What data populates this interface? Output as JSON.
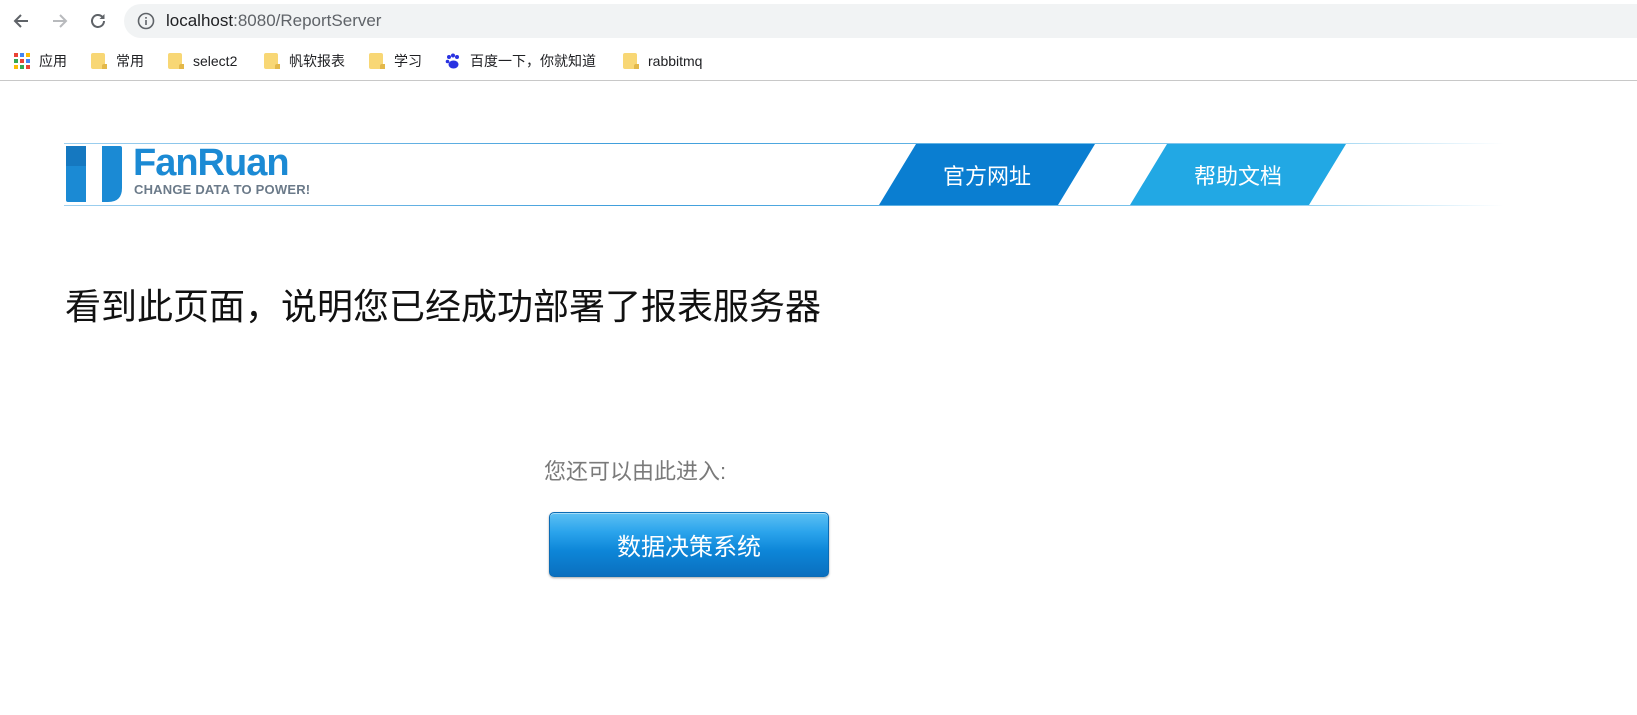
{
  "browser": {
    "url_host": "localhost",
    "url_rest": ":8080/ReportServer",
    "bookmarks": [
      {
        "label": "应用",
        "icon": "apps-grid-icon"
      },
      {
        "label": "常用",
        "icon": "folder-icon"
      },
      {
        "label": "select2",
        "icon": "folder-icon"
      },
      {
        "label": "帆软报表",
        "icon": "folder-icon"
      },
      {
        "label": "学习",
        "icon": "folder-icon"
      },
      {
        "label": "百度一下，你就知道",
        "icon": "baidu-paw-icon"
      },
      {
        "label": "rabbitmq",
        "icon": "folder-icon"
      }
    ]
  },
  "header": {
    "logo_name": "FanRuan",
    "logo_tagline": "CHANGE DATA TO POWER!",
    "links": [
      {
        "label": "官方网址",
        "color": "#0a7ed1"
      },
      {
        "label": "帮助文档",
        "color": "#22a8e4"
      }
    ]
  },
  "main": {
    "message": "看到此页面，说明您已经成功部署了报表服务器",
    "enter_prompt": "您还可以由此进入:",
    "decision_button": "数据决策系统"
  },
  "colors": {
    "brand_blue": "#1b8ad4",
    "button_blue": "#0d86d8"
  }
}
